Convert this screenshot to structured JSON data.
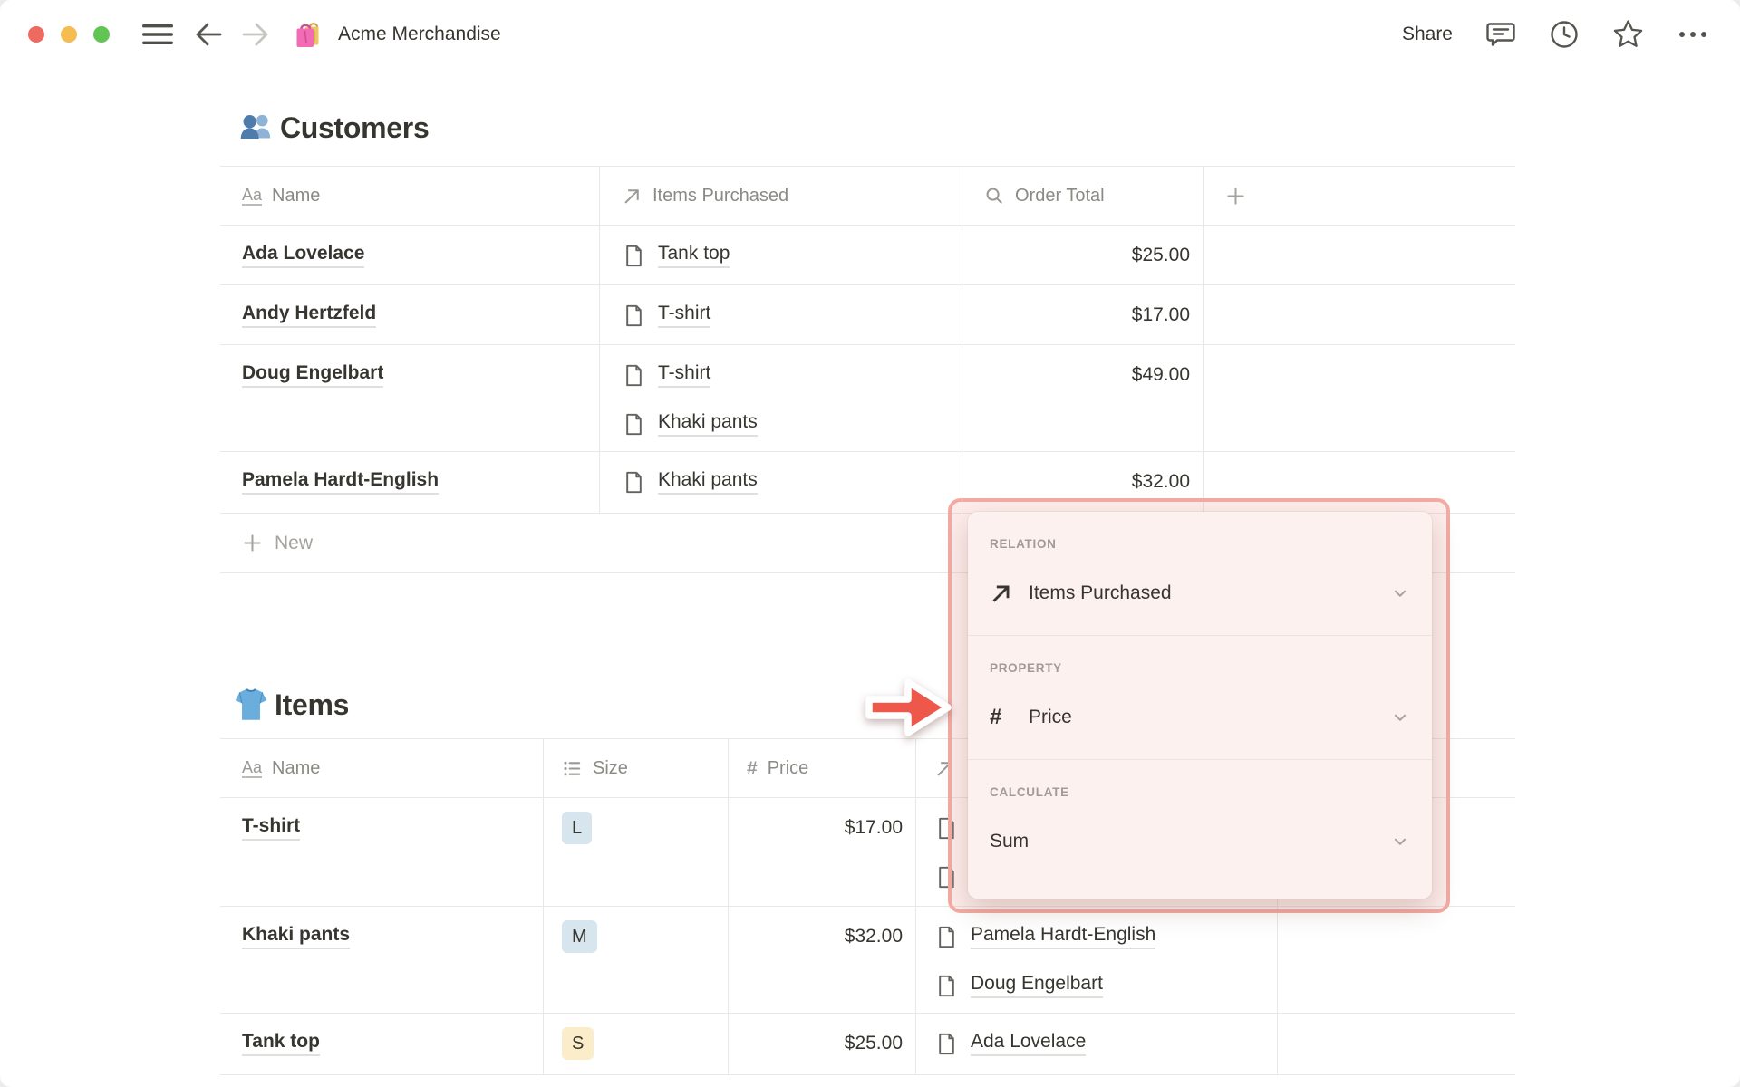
{
  "window": {
    "title": "Acme Merchandise",
    "title_icon": "shopping-bags-icon",
    "share_label": "Share"
  },
  "customers_table": {
    "heading": "Customers",
    "heading_icon": "people-emoji",
    "columns": [
      {
        "icon": "text-icon",
        "label": "Name"
      },
      {
        "icon": "relation-icon",
        "label": "Items Purchased"
      },
      {
        "icon": "rollup-icon",
        "label": "Order Total"
      },
      {
        "icon": "plus-icon",
        "label": ""
      }
    ],
    "rows": [
      {
        "name": "Ada Lovelace",
        "items_purchased": [
          "Tank top"
        ],
        "order_total": "$25.00"
      },
      {
        "name": "Andy Hertzfeld",
        "items_purchased": [
          "T-shirt"
        ],
        "order_total": "$17.00"
      },
      {
        "name": "Doug Engelbart",
        "items_purchased": [
          "T-shirt",
          "Khaki pants"
        ],
        "order_total": "$49.00"
      },
      {
        "name": "Pamela Hardt-English",
        "items_purchased": [
          "Khaki pants"
        ],
        "order_total": "$32.00"
      }
    ],
    "new_label": "New"
  },
  "items_table": {
    "heading": "Items",
    "heading_icon": "tshirt-emoji",
    "columns": [
      {
        "icon": "text-icon",
        "label": "Name"
      },
      {
        "icon": "select-icon",
        "label": "Size"
      },
      {
        "icon": "number-icon",
        "label": "Price"
      },
      {
        "icon": "relation-icon",
        "label": ""
      },
      {
        "icon": null,
        "label": ""
      }
    ],
    "rows": [
      {
        "name": "T-shirt",
        "size": "L",
        "size_color": "blue",
        "price": "$17.00",
        "customers": [
          "",
          ""
        ]
      },
      {
        "name": "Khaki pants",
        "size": "M",
        "size_color": "blue",
        "price": "$32.00",
        "customers": [
          "Pamela Hardt-English",
          "Doug Engelbart"
        ]
      },
      {
        "name": "Tank top",
        "size": "S",
        "size_color": "yellow",
        "price": "$25.00",
        "customers": [
          "Ada Lovelace"
        ]
      }
    ]
  },
  "popup": {
    "sections": [
      {
        "label": "RELATION",
        "icon": "relation-icon",
        "value": "Items Purchased"
      },
      {
        "label": "PROPERTY",
        "icon": "number-icon",
        "value": "Price"
      },
      {
        "label": "CALCULATE",
        "icon": null,
        "value": "Sum"
      }
    ]
  },
  "colors": {
    "annotation_border": "#f2aba3",
    "popup_background": "#fdf1ef",
    "arrow_red": "#ee584b",
    "chip_blue": "#d7e5ee",
    "chip_yellow": "#fbecca",
    "traffic_red": "#ee6a5f",
    "traffic_yellow": "#f5bd4f",
    "traffic_green": "#61c454"
  }
}
